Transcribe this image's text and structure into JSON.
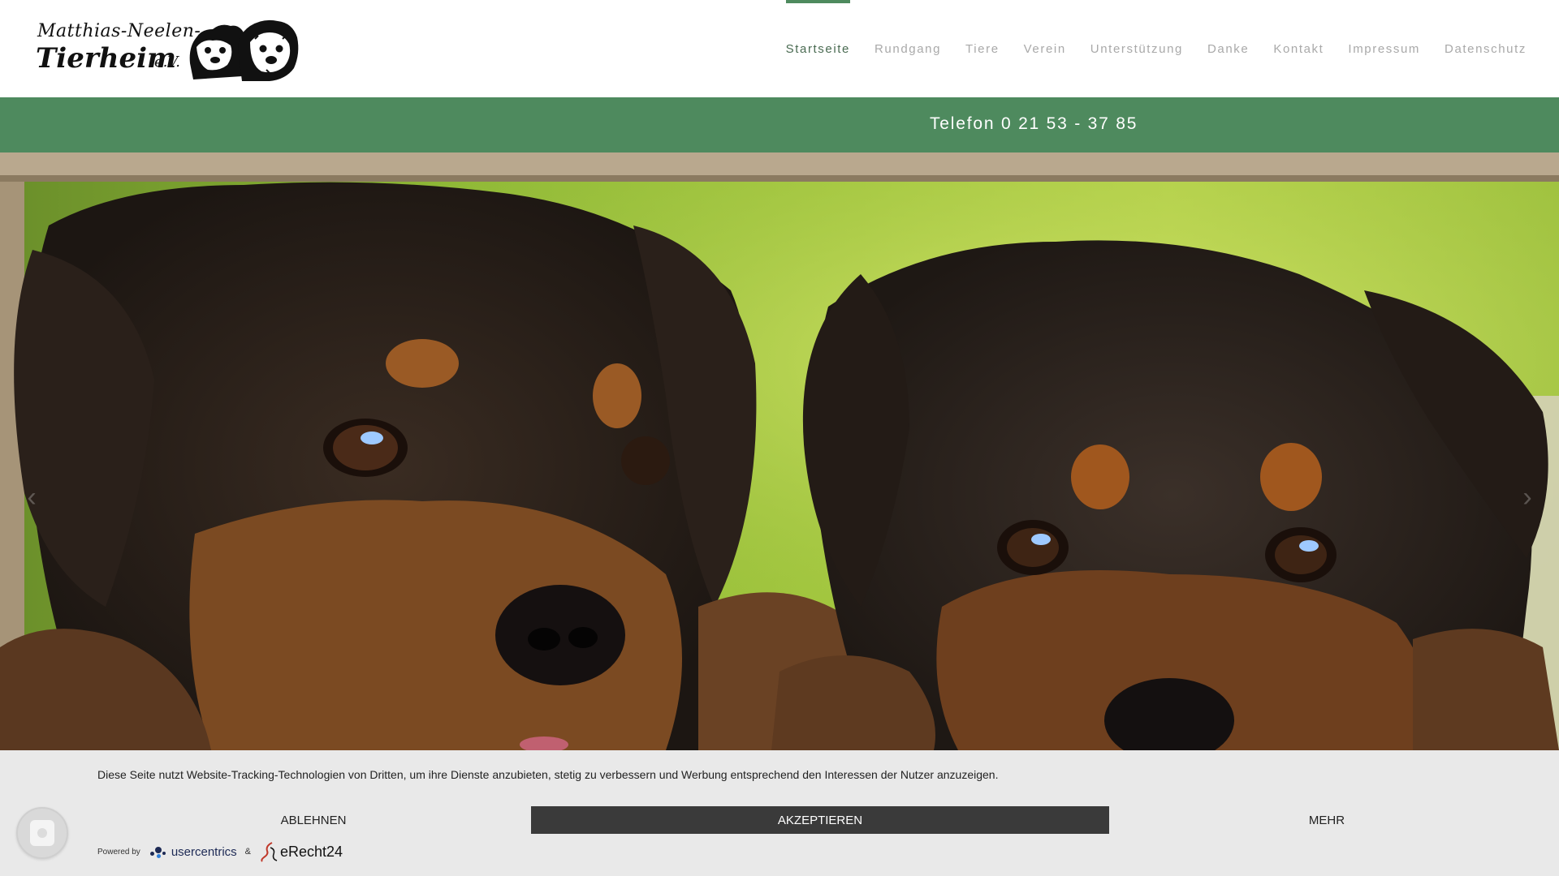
{
  "logo": {
    "line1": "Matthias-Neelen-",
    "line2": "Tierheim",
    "suffix": "e.V."
  },
  "nav": {
    "items": [
      {
        "label": "Startseite",
        "active": true
      },
      {
        "label": "Rundgang"
      },
      {
        "label": "Tiere"
      },
      {
        "label": "Verein"
      },
      {
        "label": "Unterstützung"
      },
      {
        "label": "Danke"
      },
      {
        "label": "Kontakt"
      },
      {
        "label": "Impressum"
      },
      {
        "label": "Datenschutz"
      }
    ]
  },
  "phonebar": {
    "text": "Telefon 0 21 53 - 37 85"
  },
  "hero": {
    "prev_icon": "chevron-left-icon",
    "next_icon": "chevron-right-icon",
    "prev_glyph": "‹",
    "next_glyph": "›"
  },
  "cookie_banner": {
    "text": "Diese Seite nutzt Website-Tracking-Technologien von Dritten, um ihre Dienste anzubieten, stetig zu verbessern und Werbung entsprechend den Interessen der Nutzer anzuzeigen.",
    "deny_label": "ABLEHNEN",
    "accept_label": "AKZEPTIEREN",
    "more_label": "MEHR",
    "powered_by": "Powered by",
    "brand1": "usercentrics",
    "ampersand": "&",
    "brand2": "eRecht24"
  },
  "colors": {
    "accent": "#4e8a5e",
    "accept_button": "#3a3a3a",
    "banner_bg": "#e9e9e9"
  }
}
